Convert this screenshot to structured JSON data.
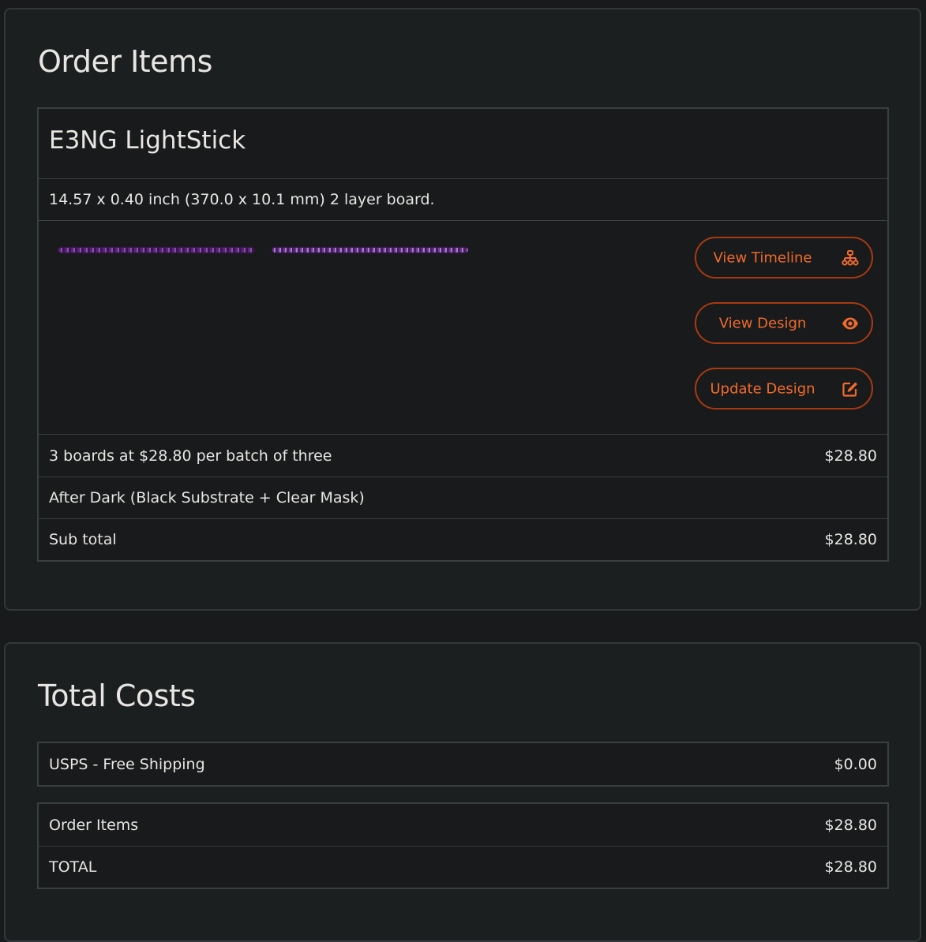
{
  "order_items": {
    "title": "Order Items",
    "item": {
      "name": "E3NG LightStick",
      "spec": "14.57 x 0.40 inch (370.0 x 10.1 mm) 2 layer board.",
      "buttons": {
        "timeline": "View Timeline",
        "view_design": "View Design",
        "update_design": "Update Design"
      },
      "icons": {
        "timeline": "sitemap-icon",
        "view_design": "eye-icon",
        "update_design": "edit-icon"
      },
      "price_line": "3 boards at $28.80 per batch of three",
      "price_amount": "$28.80",
      "finish": "After Dark (Black Substrate + Clear Mask)",
      "subtotal_label": "Sub total",
      "subtotal_amount": "$28.80"
    }
  },
  "total_costs": {
    "title": "Total Costs",
    "shipping_label": "USPS - Free Shipping",
    "shipping_amount": "$0.00",
    "order_items_label": "Order Items",
    "order_items_amount": "$28.80",
    "total_label": "TOTAL",
    "total_amount": "$28.80"
  },
  "colors": {
    "accent": "#f06a2c",
    "accent_border": "#a83a12",
    "board_purple": "#6a3890"
  }
}
